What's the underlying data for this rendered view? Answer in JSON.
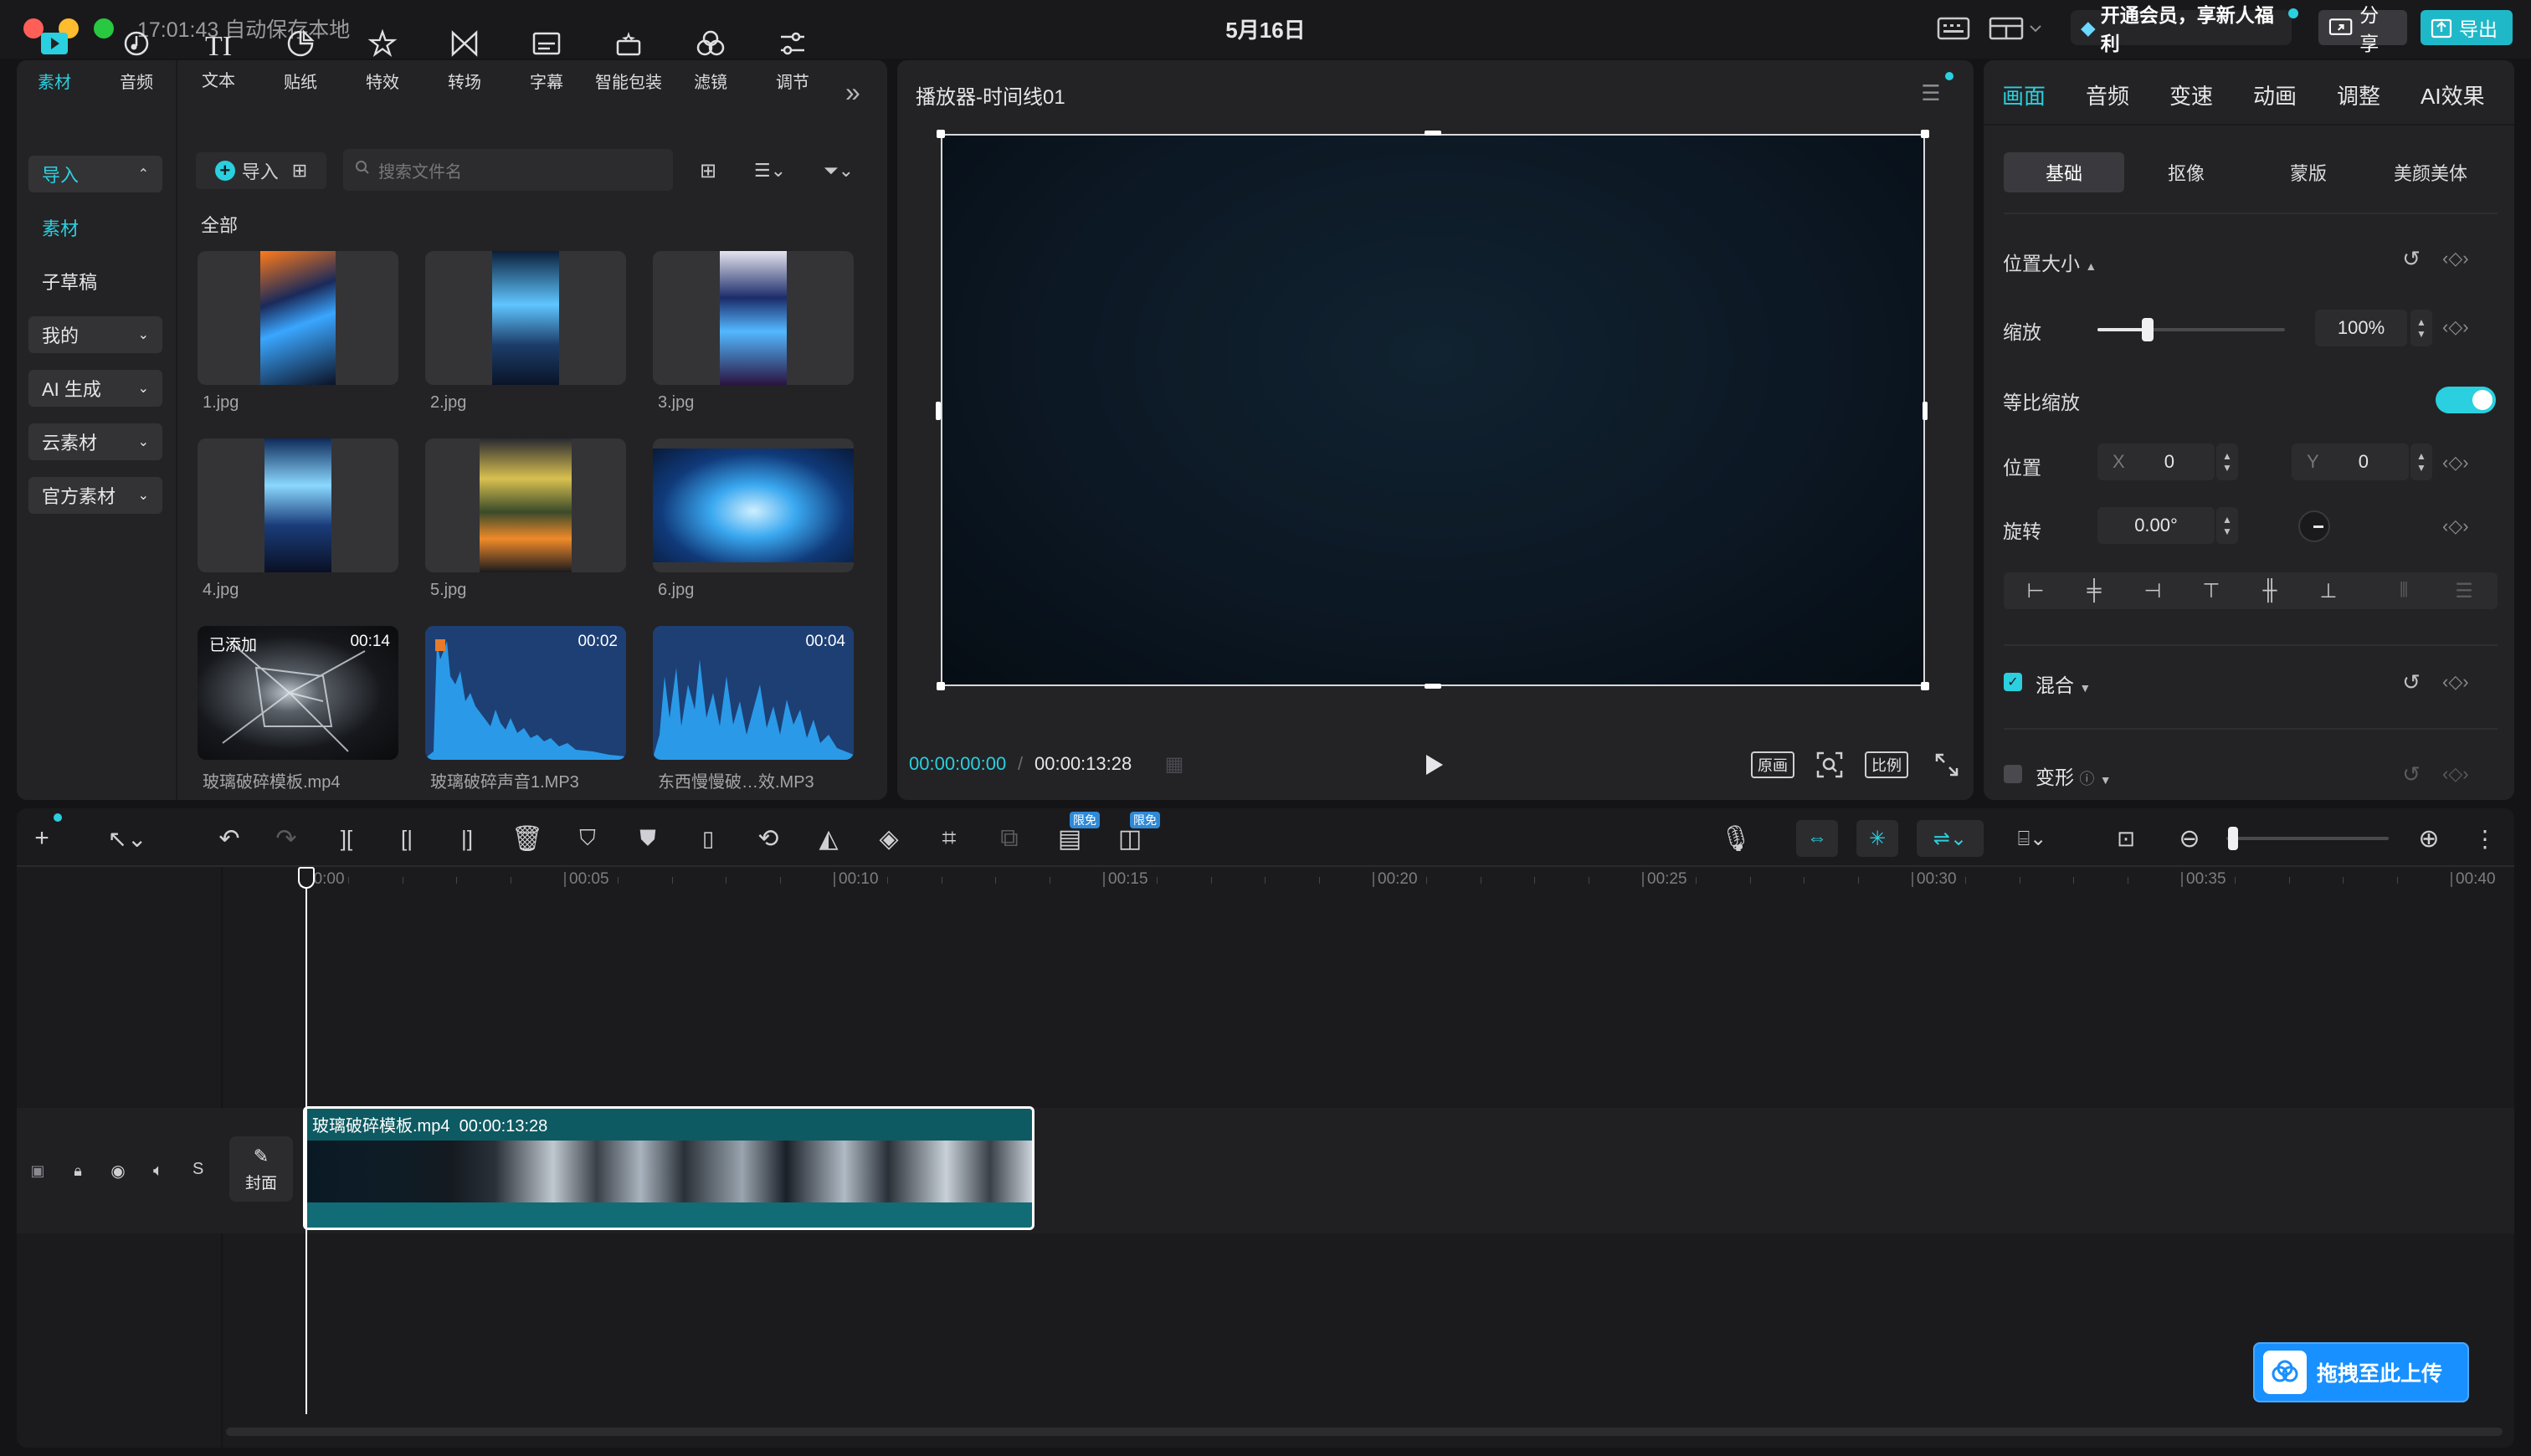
{
  "titlebar": {
    "time_status": "17:01:43 自动保存本地",
    "center_title": "5月16日",
    "vip_label": "开通会员，享新人福利",
    "share_label": "分享",
    "export_label": "导出"
  },
  "toolbar": {
    "items": [
      {
        "label": "素材",
        "icon": "media-icon"
      },
      {
        "label": "音频",
        "icon": "audio-icon"
      },
      {
        "label": "文本",
        "icon": "text-icon"
      },
      {
        "label": "贴纸",
        "icon": "sticker-icon"
      },
      {
        "label": "特效",
        "icon": "effects-icon"
      },
      {
        "label": "转场",
        "icon": "transition-icon"
      },
      {
        "label": "字幕",
        "icon": "subtitle-icon"
      },
      {
        "label": "智能包装",
        "icon": "smart-pack-icon"
      },
      {
        "label": "滤镜",
        "icon": "filter-icon"
      },
      {
        "label": "调节",
        "icon": "adjust-icon"
      }
    ],
    "more_glyph": "»"
  },
  "sidebar": {
    "import": "导入",
    "media": "素材",
    "sub_draft": "子草稿",
    "mine": "我的",
    "ai_gen": "AI 生成",
    "cloud": "云素材",
    "official": "官方素材"
  },
  "media": {
    "import_button": "导入",
    "search_placeholder": "搜索文件名",
    "section_all": "全部",
    "items": [
      {
        "name": "1.jpg",
        "type": "image"
      },
      {
        "name": "2.jpg",
        "type": "image"
      },
      {
        "name": "3.jpg",
        "type": "image"
      },
      {
        "name": "4.jpg",
        "type": "image"
      },
      {
        "name": "5.jpg",
        "type": "image"
      },
      {
        "name": "6.jpg",
        "type": "image"
      },
      {
        "name": "玻璃破碎模板.mp4",
        "type": "video",
        "badge": "已添加",
        "duration": "00:14"
      },
      {
        "name": "玻璃破碎声音1.MP3",
        "type": "audio",
        "duration": "00:02"
      },
      {
        "name": "东西慢慢破…效.MP3",
        "type": "audio",
        "duration": "00:04"
      }
    ]
  },
  "player": {
    "title": "播放器-时间线01",
    "current_time": "00:00:00:00",
    "total_time": "00:00:13:28",
    "btn_original": "原画",
    "btn_ratio": "比例",
    "bg_color": "#0c1824"
  },
  "inspector": {
    "tabs": [
      "画面",
      "音频",
      "变速",
      "动画",
      "调整",
      "AI效果"
    ],
    "subtabs": [
      "基础",
      "抠像",
      "蒙版",
      "美颜美体"
    ],
    "section_pos_size": "位置大小",
    "scale_label": "缩放",
    "scale_value": "100%",
    "scale_slider": 0.27,
    "uniform_label": "等比缩放",
    "uniform_on": true,
    "position_label": "位置",
    "x_label": "X",
    "x_value": "0",
    "y_label": "Y",
    "y_value": "0",
    "rotate_label": "旋转",
    "rotate_value": "0.00°",
    "blend_label": "混合",
    "blend_checked": true,
    "transform_label": "变形",
    "transform_checked": false
  },
  "timeline": {
    "ruler": [
      "00:00",
      "00:05",
      "00:10",
      "00:15",
      "00:20",
      "00:25",
      "00:30",
      "00:35",
      "00:40"
    ],
    "badge_free": "限免",
    "cover_label": "封面",
    "track_s": "S",
    "clip_name": "玻璃破碎模板.mp4",
    "clip_duration": "00:00:13:28",
    "zoom_level": 0.04
  },
  "upload_button": "拖拽至此上传",
  "colors": {
    "accent": "#2ad0df",
    "clip": "#0e5a62"
  }
}
